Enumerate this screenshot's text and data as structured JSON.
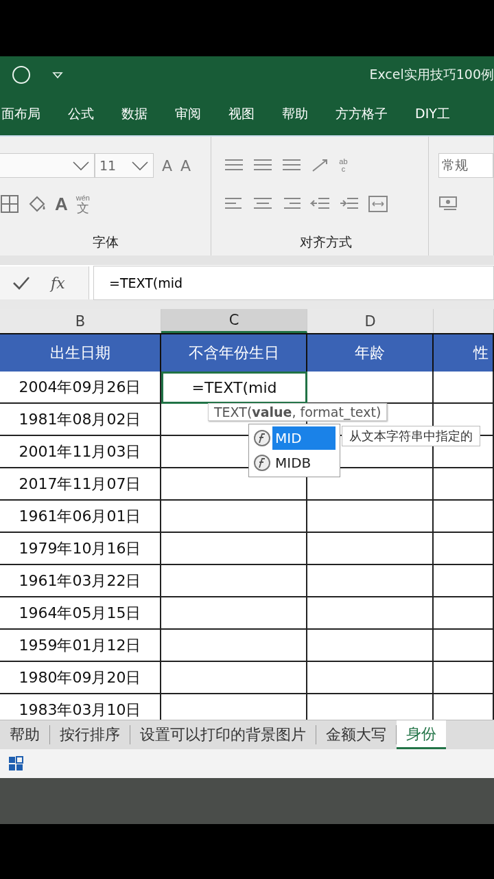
{
  "title_bar": {
    "title": "Excel实用技巧100例"
  },
  "ribbon_tabs": [
    "面布局",
    "公式",
    "数据",
    "审阅",
    "视图",
    "帮助",
    "方方格子",
    "DIY工"
  ],
  "ribbon": {
    "font_size": "11",
    "grow_font": "A",
    "shrink_font": "A",
    "font_color": "A",
    "phonetic_top": "wén",
    "phonetic_bottom": "文",
    "wrap_top": "ab",
    "wrap_bottom": "c",
    "font_group": "字体",
    "alignment_group": "对齐方式",
    "number_format": "常规"
  },
  "formula_bar": {
    "function_label": "fx",
    "value": "=TEXT(mid"
  },
  "columns": [
    {
      "letter": "B",
      "selected": false
    },
    {
      "letter": "C",
      "selected": true
    },
    {
      "letter": "D",
      "selected": false
    }
  ],
  "table": {
    "headers": [
      "出生日期",
      "不含年份生日",
      "年龄",
      "性"
    ],
    "rows": [
      {
        "birth_date": "2004年09月26日",
        "birthday": "=TEXT(mid",
        "selected": true
      },
      {
        "birth_date": "1981年08月02日",
        "selected": false
      },
      {
        "birth_date": "2001年11月03日",
        "selected": false
      },
      {
        "birth_date": "2017年11月07日",
        "selected": false
      },
      {
        "birth_date": "1961年06月01日",
        "selected": false
      },
      {
        "birth_date": "1979年10月16日",
        "selected": false
      },
      {
        "birth_date": "1961年03月22日",
        "selected": false
      },
      {
        "birth_date": "1964年05月15日",
        "selected": false
      },
      {
        "birth_date": "1959年01月12日",
        "selected": false
      },
      {
        "birth_date": "1980年09月20日",
        "selected": false
      },
      {
        "birth_date": "1983年03月10日",
        "selected": false
      }
    ]
  },
  "formula_tooltip": "TEXT(**value**, format_text)",
  "autocomplete": {
    "items": [
      {
        "label": "MID",
        "selected": true
      },
      {
        "label": "MIDB",
        "selected": false
      }
    ],
    "description": "从文本字符串中指定的"
  },
  "sheet_tabs": [
    {
      "label": "帮助",
      "selected": false
    },
    {
      "label": "按行排序",
      "selected": false
    },
    {
      "label": "设置可以打印的背景图片",
      "selected": false
    },
    {
      "label": "金额大写",
      "selected": false
    },
    {
      "label": "身份",
      "selected": true
    }
  ]
}
